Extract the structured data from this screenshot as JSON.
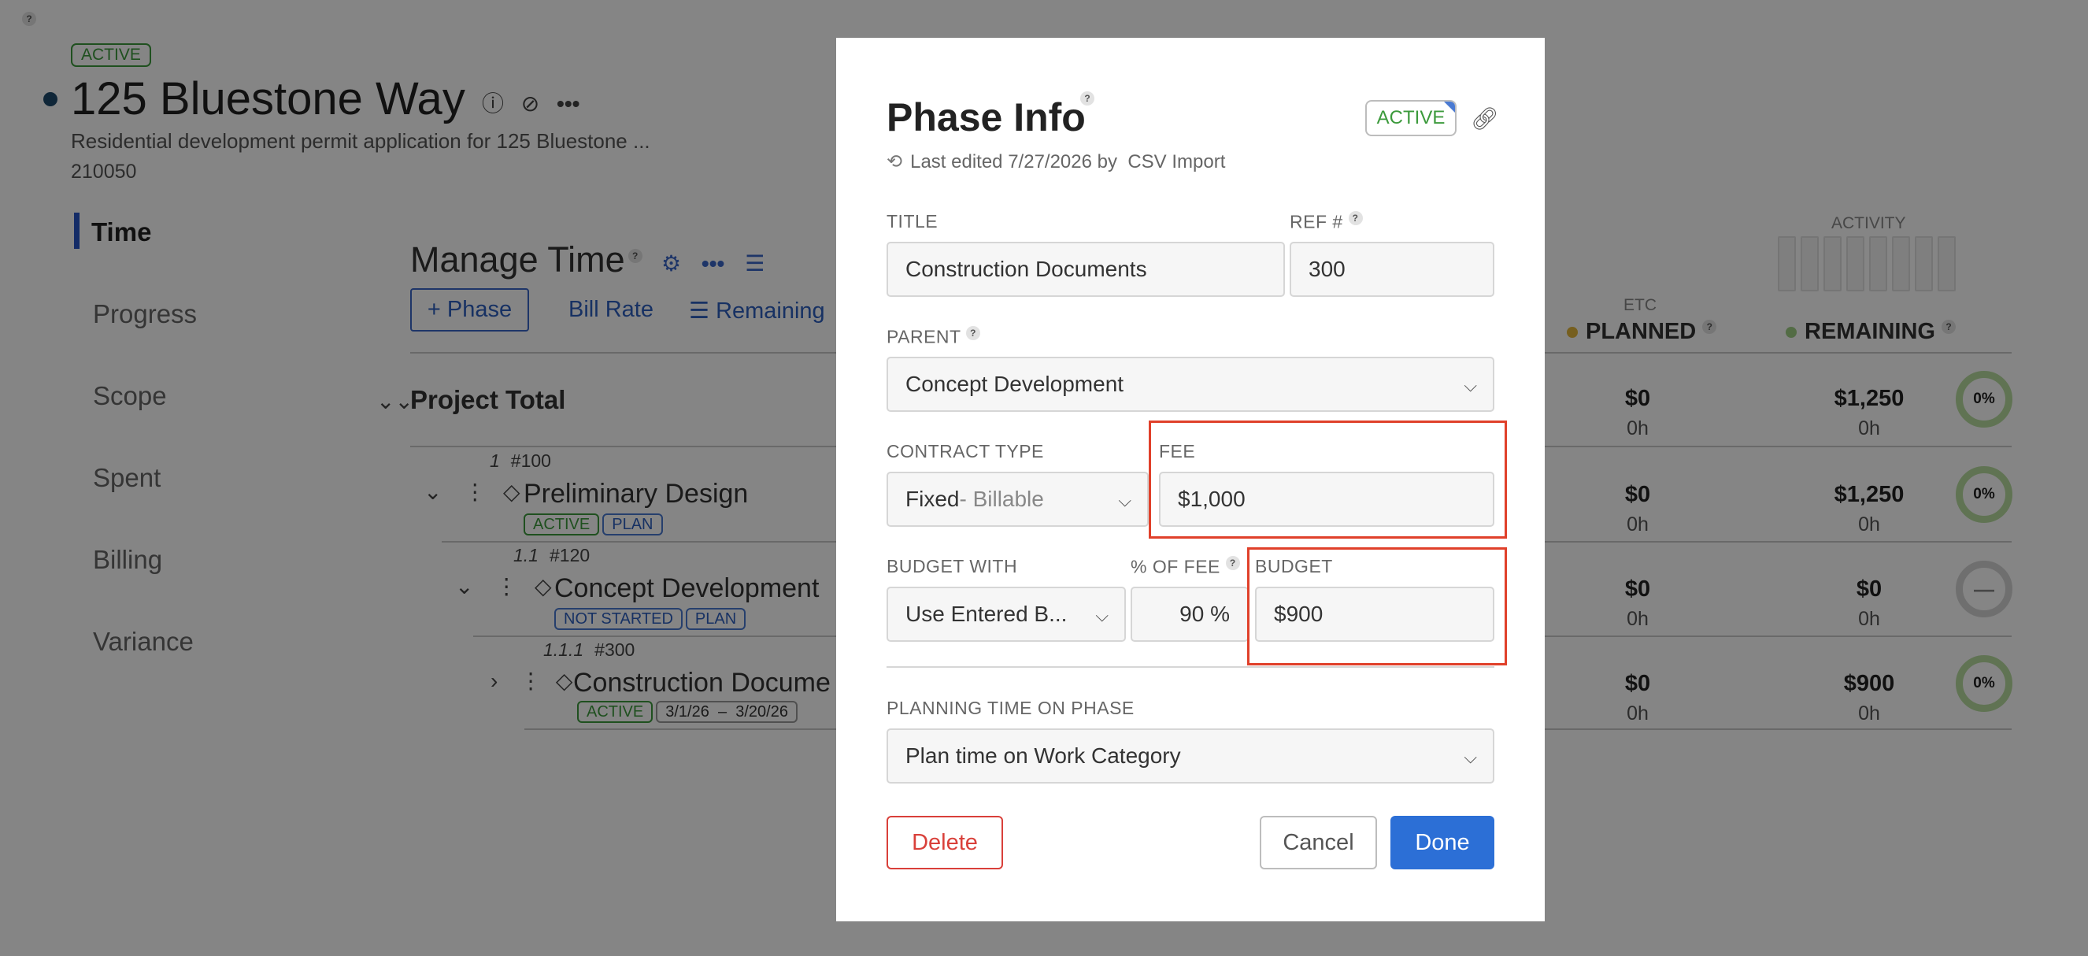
{
  "project": {
    "status": "ACTIVE",
    "title": "125 Bluestone Way",
    "description": "Residential development permit application for 125 Bluestone ...",
    "number": "210050"
  },
  "nav": {
    "active": "Time",
    "items": [
      "Progress",
      "Scope",
      "Spent",
      "Billing",
      "Variance"
    ]
  },
  "manage_time": {
    "title": "Manage Time",
    "add_phase": "+ Phase",
    "bill_rate": "Bill Rate",
    "remaining": "Remaining",
    "project_total": "Project Total"
  },
  "columns": {
    "etc": "ETC",
    "planned": "PLANNED",
    "remaining": "REMAINING",
    "activity": "ACTIVITY",
    "planned_color": "#e3b63c",
    "remaining_color": "#9fcf84"
  },
  "rows": [
    {
      "index": "1",
      "ref": "#100",
      "name": "Preliminary Design",
      "badges": [
        "ACTIVE",
        "PLAN"
      ],
      "planned": "$0",
      "planned_hrs": "0h",
      "remaining": "$1,250",
      "remaining_hrs": "0h",
      "pct": "0%"
    },
    {
      "index": "1.1",
      "ref": "#120",
      "name": "Concept Development",
      "badges": [
        "NOT STARTED",
        "PLAN"
      ],
      "planned": "$0",
      "planned_hrs": "0h",
      "remaining": "$0",
      "remaining_hrs": "0h",
      "pct": "—"
    },
    {
      "index": "1.1.1",
      "ref": "#300",
      "name": "Construction Docume",
      "badges": [
        "ACTIVE",
        "3/1/26",
        "–",
        "3/20/26"
      ],
      "planned": "$0",
      "planned_hrs": "0h",
      "remaining": "$900",
      "remaining_hrs": "0h",
      "pct": "0%"
    }
  ],
  "total": {
    "planned": "$0",
    "planned_hrs": "0h",
    "remaining": "$1,250",
    "remaining_hrs": "0h",
    "pct": "0%"
  },
  "modal": {
    "title": "Phase Info",
    "status": "ACTIVE",
    "edited_prefix": "Last edited 7/27/2026 by",
    "edited_by": "CSV Import",
    "title_label": "TITLE",
    "title_value": "Construction Documents",
    "ref_label": "REF #",
    "ref_value": "300",
    "parent_label": "PARENT",
    "parent_value": "Concept Development",
    "contract_type_label": "CONTRACT TYPE",
    "contract_type_value": "Fixed",
    "contract_type_sub": " - Billable",
    "fee_label": "FEE",
    "fee_value": "$1,000",
    "budget_with_label": "BUDGET WITH",
    "budget_with_value": "Use Entered B...",
    "pct_fee_label": "% OF FEE",
    "pct_fee_value": "90 %",
    "budget_label": "BUDGET",
    "budget_value": "$900",
    "planning_label": "PLANNING TIME ON PHASE",
    "planning_value": "Plan time on Work Category",
    "delete": "Delete",
    "cancel": "Cancel",
    "done": "Done"
  },
  "colors": {
    "accent": "#2c6fd6",
    "highlight": "#e0402a",
    "active_green": "#3c9a3c",
    "danger": "#d9403a"
  }
}
